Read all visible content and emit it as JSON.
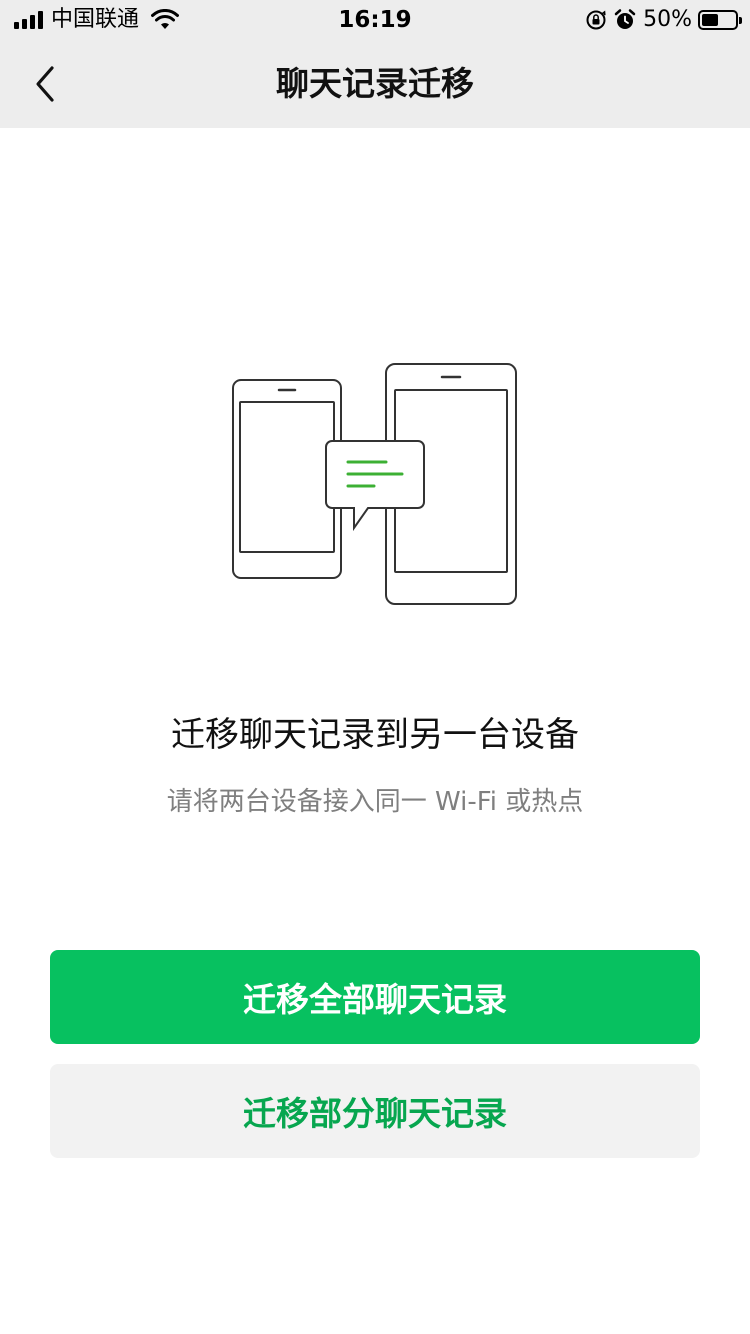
{
  "status_bar": {
    "carrier": "中国联通",
    "time": "16:19",
    "battery_percent": "50%",
    "battery_level": 0.5,
    "icons": [
      "signal-icon",
      "wifi-icon",
      "orientation-lock-icon",
      "alarm-icon",
      "battery-icon"
    ]
  },
  "nav": {
    "back_icon": "chevron-left-icon",
    "title": "聊天记录迁移"
  },
  "illustration": {
    "icon": "device-transfer-illustration",
    "accent_color": "#3cb034"
  },
  "content": {
    "title": "迁移聊天记录到另一台设备",
    "subtitle": "请将两台设备接入同一 Wi-Fi 或热点"
  },
  "buttons": {
    "migrate_all": "迁移全部聊天记录",
    "migrate_partial": "迁移部分聊天记录"
  },
  "colors": {
    "primary": "#07c160",
    "header_bg": "#ededed",
    "secondary_bg": "#f2f2f2"
  }
}
